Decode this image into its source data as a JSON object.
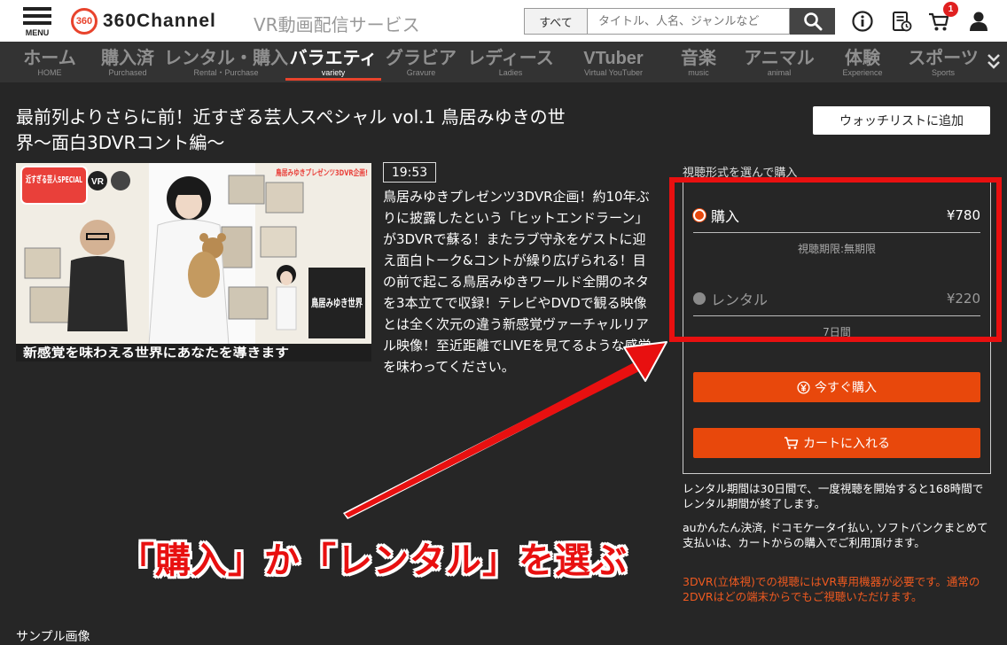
{
  "header": {
    "menu_label": "MENU",
    "logo_text": "360Channel",
    "logo_mark": "360",
    "tagline": "VR動画配信サービス",
    "search": {
      "category": "すべて",
      "placeholder": "タイトル、人名、ジャンルなど"
    },
    "cart_count": "1",
    "icons": [
      "menu-icon",
      "search-icon",
      "info-icon",
      "history-icon",
      "cart-icon",
      "user-icon"
    ]
  },
  "nav": {
    "items": [
      {
        "label": "ホーム",
        "sub": "HOME"
      },
      {
        "label": "購入済",
        "sub": "Purchased"
      },
      {
        "label": "レンタル・購入",
        "sub": "Rental・Purchase"
      },
      {
        "label": "バラエティ",
        "sub": "variety",
        "active": true
      },
      {
        "label": "グラビア",
        "sub": "Gravure"
      },
      {
        "label": "レディース",
        "sub": "Ladies"
      },
      {
        "label": "VTuber",
        "sub": "Virtual YouTuber"
      },
      {
        "label": "音楽",
        "sub": "music"
      },
      {
        "label": "アニマル",
        "sub": "animal"
      },
      {
        "label": "体験",
        "sub": "Experience"
      },
      {
        "label": "スポーツ",
        "sub": "Sports"
      }
    ]
  },
  "video": {
    "title": "最前列よりさらに前！近すぎる芸人スペシャル vol.1 鳥居みゆきの世界〜面白3DVRコント編〜",
    "duration": "19:53",
    "description": "鳥居みゆきプレゼンツ3DVR企画！約10年ぶりに披露したという「ヒットエンドラーン」が3DVRで蘇る！またラブ守永をゲストに迎え面白トーク&コントが繰り広げられる！目の前で起こる鳥居みゆきワールド全開のネタを3本立てで収録！テレビやDVDで観る映像とは全く次元の違う新感覚ヴァーチャルリアル映像！至近距離でLIVEを見てるような感覚を味わってください。",
    "watchlist_label": "ウォッチリストに追加",
    "thumbnail": {
      "banner_text": "新感覚を味わえる世界にあなたを導きます",
      "name_text": "鳥居みゆき世界",
      "badge_text": "近すぎる芸人SPECIAL",
      "vr_badge": "VR",
      "plan_text": "鳥居みゆきプレゼンツ3DVR企画!"
    },
    "sample_label": "サンプル画像"
  },
  "purchase": {
    "heading": "視聴形式を選んで購入",
    "options": [
      {
        "name": "購入",
        "price": "¥780",
        "note": "視聴期限:無期限",
        "selected": true
      },
      {
        "name": "レンタル",
        "price": "¥220",
        "note": "7日間",
        "selected": false
      }
    ],
    "buy_now_label": "今すぐ購入",
    "add_cart_label": "カートに入れる",
    "info_1": "レンタル期間は30日間で、一度視聴を開始すると168時間でレンタル期間が終了します。",
    "info_2": "auかんたん決済, ドコモケータイ払い, ソフトバンクまとめて支払いは、カートからの購入でご利用頂けます。",
    "warning": "3DVR(立体視)での視聴にはVR専用機器が必要です。通常の2DVRはどの端末からでもご視聴いただけます。"
  },
  "annotation": {
    "text": "「購入」か「レンタル」を選ぶ",
    "color": "#e81010"
  },
  "colors": {
    "accent": "#e8480c",
    "background": "#262626",
    "nav_bg": "#333333"
  }
}
